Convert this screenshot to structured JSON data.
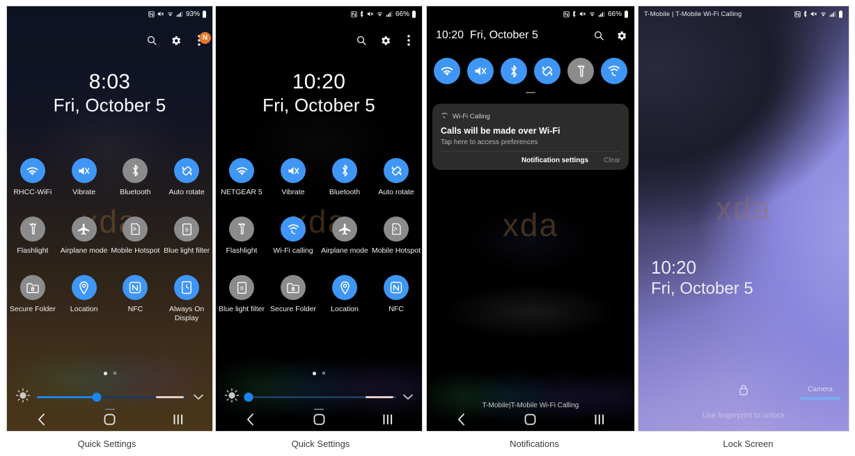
{
  "captions": [
    "Quick Settings",
    "Quick Settings",
    "Notifications",
    "Lock Screen"
  ],
  "watermark": "xda",
  "panel1": {
    "statusbar": {
      "battery_percent": "93%",
      "icons": [
        "nfc-icon",
        "mute-icon",
        "wifi-icon",
        "signal-icon",
        "battery-icon"
      ]
    },
    "topbar": {
      "search": "search-icon",
      "settings": "gear-icon",
      "menu": "overflow-menu-icon",
      "badge": "N"
    },
    "clock": {
      "time": "8:03",
      "date": "Fri, October 5"
    },
    "toggles": [
      {
        "label": "RHCC-WiFi",
        "icon": "wifi-icon",
        "state": "on"
      },
      {
        "label": "Vibrate",
        "icon": "vibrate-icon",
        "state": "on"
      },
      {
        "label": "Bluetooth",
        "icon": "bluetooth-icon",
        "state": "off"
      },
      {
        "label": "Auto rotate",
        "icon": "autorotate-icon",
        "state": "on"
      },
      {
        "label": "Flashlight",
        "icon": "flashlight-icon",
        "state": "off"
      },
      {
        "label": "Airplane mode",
        "icon": "airplane-icon",
        "state": "off"
      },
      {
        "label": "Mobile Hotspot",
        "icon": "hotspot-icon",
        "state": "off"
      },
      {
        "label": "Blue light filter",
        "icon": "bluelight-icon",
        "state": "off"
      },
      {
        "label": "Secure Folder",
        "icon": "securefolder-icon",
        "state": "off"
      },
      {
        "label": "Location",
        "icon": "location-icon",
        "state": "on"
      },
      {
        "label": "NFC",
        "icon": "nfc-icon",
        "state": "on"
      },
      {
        "label": "Always On Display",
        "icon": "aod-icon",
        "state": "on"
      }
    ],
    "brightness": {
      "icon": "brightness-icon",
      "value_percent": 40,
      "expand": "chevron-down-icon"
    },
    "page_dots": {
      "count": 2,
      "active": 0
    },
    "navbar": [
      "back-icon",
      "home-icon",
      "recents-icon"
    ]
  },
  "panel2": {
    "statusbar": {
      "battery_percent": "66%",
      "icons": [
        "nfc-icon",
        "bluetooth-icon",
        "mute-icon",
        "wifi-icon",
        "signal-icon",
        "battery-icon"
      ]
    },
    "topbar": {
      "search": "search-icon",
      "settings": "gear-icon",
      "menu": "overflow-menu-icon"
    },
    "clock": {
      "time": "10:20",
      "date": "Fri, October 5"
    },
    "toggles": [
      {
        "label": "NETGEAR 5",
        "icon": "wifi-icon",
        "state": "on"
      },
      {
        "label": "Vibrate",
        "icon": "vibrate-icon",
        "state": "on"
      },
      {
        "label": "Bluetooth",
        "icon": "bluetooth-icon",
        "state": "on"
      },
      {
        "label": "Auto rotate",
        "icon": "autorotate-icon",
        "state": "on"
      },
      {
        "label": "Flashlight",
        "icon": "flashlight-icon",
        "state": "off"
      },
      {
        "label": "Wi-Fi calling",
        "icon": "wificalling-icon",
        "state": "on"
      },
      {
        "label": "Airplane mode",
        "icon": "airplane-icon",
        "state": "off"
      },
      {
        "label": "Mobile Hotspot",
        "icon": "hotspot-icon",
        "state": "off"
      },
      {
        "label": "Blue light filter",
        "icon": "bluelight-icon",
        "state": "off"
      },
      {
        "label": "Secure Folder",
        "icon": "securefolder-icon",
        "state": "off"
      },
      {
        "label": "Location",
        "icon": "location-icon",
        "state": "on"
      },
      {
        "label": "NFC",
        "icon": "nfc-icon",
        "state": "on"
      }
    ],
    "brightness": {
      "icon": "brightness-icon",
      "value_percent": 2,
      "expand": "chevron-down-icon"
    },
    "page_dots": {
      "count": 2,
      "active": 0
    },
    "navbar": [
      "back-icon",
      "home-icon",
      "recents-icon"
    ]
  },
  "panel3": {
    "statusbar": {
      "battery_percent": "66%",
      "icons": [
        "nfc-icon",
        "bluetooth-icon",
        "mute-icon",
        "wifi-icon",
        "signal-icon",
        "battery-icon"
      ]
    },
    "header": {
      "time": "10:20",
      "date": "Fri, October 5",
      "search": "search-icon",
      "settings": "gear-icon"
    },
    "toggles": [
      {
        "icon": "wifi-icon",
        "state": "on"
      },
      {
        "icon": "vibrate-icon",
        "state": "on"
      },
      {
        "icon": "bluetooth-icon",
        "state": "on"
      },
      {
        "icon": "autorotate-icon",
        "state": "on"
      },
      {
        "icon": "flashlight-icon",
        "state": "off"
      },
      {
        "icon": "wificalling-icon",
        "state": "on"
      }
    ],
    "notification": {
      "app_icon": "wificalling-icon",
      "app_name": "Wi-Fi Calling",
      "title": "Calls will be made over Wi-Fi",
      "subtitle": "Tap here to access preferences",
      "actions": {
        "settings": "Notification settings",
        "clear": "Clear"
      }
    },
    "carrier": "T-Mobile|T-Mobile Wi-Fi Calling",
    "navbar": [
      "back-icon",
      "home-icon",
      "recents-icon"
    ]
  },
  "panel4": {
    "statusbar": {
      "carrier": "T-Mobile | T-Mobile Wi-Fi Calling",
      "icons": [
        "nfc-icon",
        "bluetooth-icon",
        "mute-icon",
        "wifi-icon",
        "signal-icon",
        "battery-icon"
      ]
    },
    "clock": {
      "time": "10:20",
      "date": "Fri, October 5"
    },
    "lock_icon": "lock-icon",
    "hint": "Use fingerprint to unlock",
    "camera": {
      "label": "Camera",
      "shortcut": "camera-shortcut-bar"
    }
  },
  "colors": {
    "accent_on": "#3f96f5",
    "toggle_off": "#8b8b8b",
    "slider_fill": "#1b84f0",
    "badge": "#e8762a",
    "notif_card": "#2c2c2c"
  }
}
